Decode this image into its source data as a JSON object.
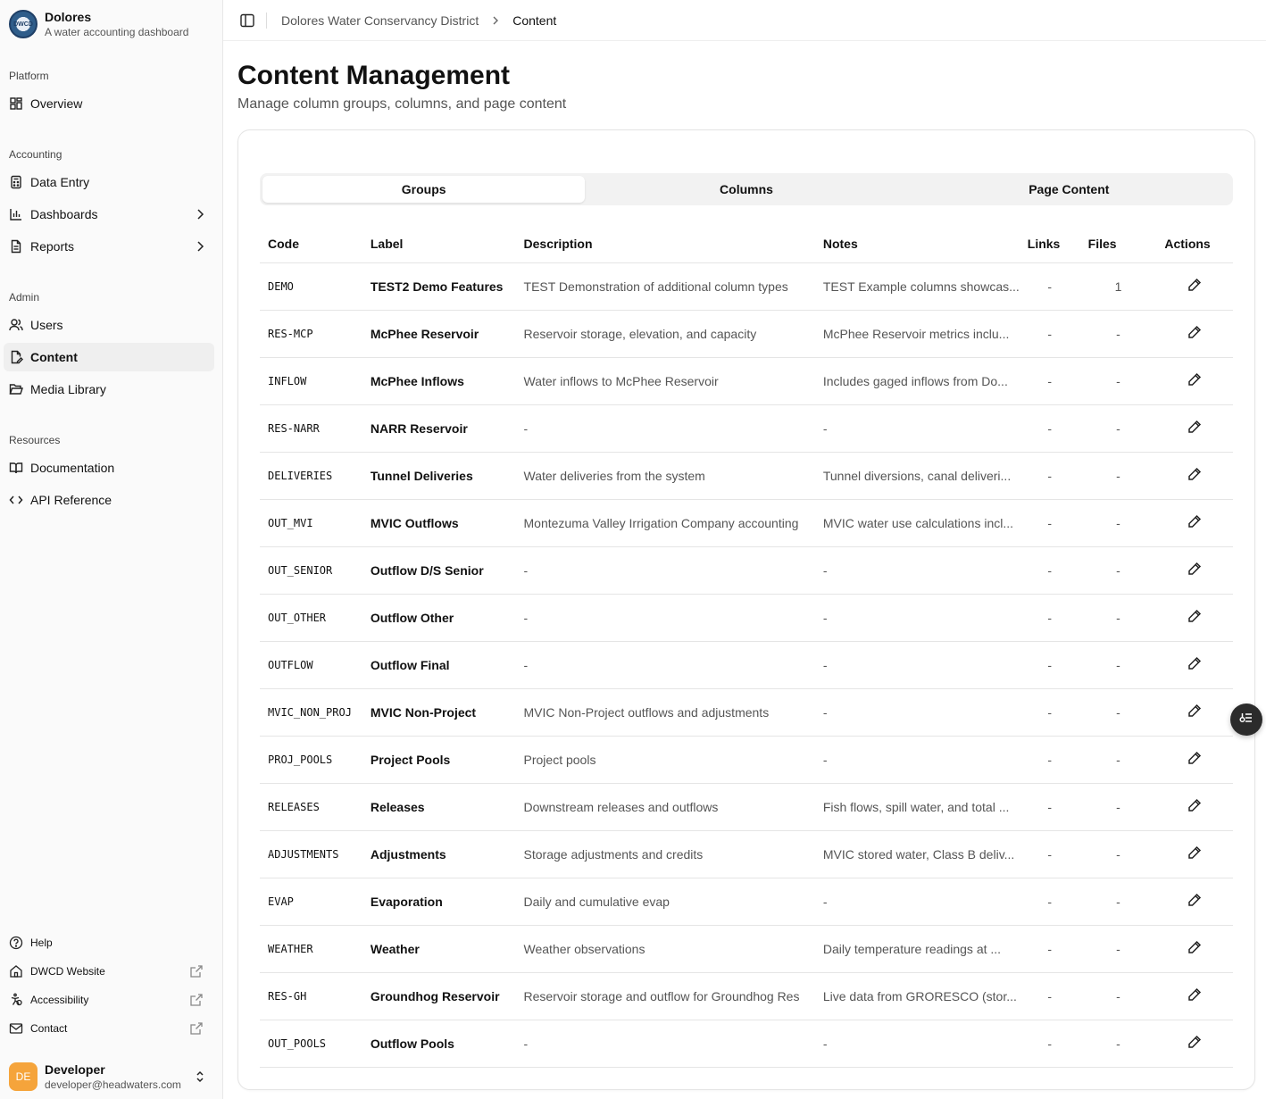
{
  "brand": {
    "title": "Dolores",
    "subtitle": "A water accounting dashboard",
    "logo_text": "DWCD"
  },
  "sections": {
    "platform": "Platform",
    "accounting": "Accounting",
    "admin": "Admin",
    "resources": "Resources"
  },
  "nav": {
    "overview": "Overview",
    "data_entry": "Data Entry",
    "dashboards": "Dashboards",
    "reports": "Reports",
    "users": "Users",
    "content": "Content",
    "media_library": "Media Library",
    "documentation": "Documentation",
    "api_reference": "API Reference"
  },
  "footer": {
    "help": "Help",
    "website": "DWCD Website",
    "accessibility": "Accessibility",
    "contact": "Contact"
  },
  "user": {
    "initials": "DE",
    "name": "Developer",
    "email": "developer@headwaters.com"
  },
  "breadcrumb": {
    "parent": "Dolores Water Conservancy District",
    "current": "Content"
  },
  "page": {
    "title": "Content Management",
    "subtitle": "Manage column groups, columns, and page content"
  },
  "tabs": [
    "Groups",
    "Columns",
    "Page Content"
  ],
  "table": {
    "headers": {
      "code": "Code",
      "label": "Label",
      "description": "Description",
      "notes": "Notes",
      "links": "Links",
      "files": "Files",
      "actions": "Actions"
    },
    "rows": [
      {
        "code": "DEMO",
        "label": "TEST2 Demo Features",
        "description": "TEST Demonstration of additional column types",
        "notes": "TEST Example columns showcas...",
        "links": "-",
        "files": "1"
      },
      {
        "code": "RES-MCP",
        "label": "McPhee Reservoir",
        "description": "Reservoir storage, elevation, and capacity",
        "notes": "McPhee Reservoir metrics inclu...",
        "links": "-",
        "files": "-"
      },
      {
        "code": "INFLOW",
        "label": "McPhee Inflows",
        "description": "Water inflows to McPhee Reservoir",
        "notes": "Includes gaged inflows from Do...",
        "links": "-",
        "files": "-"
      },
      {
        "code": "RES-NARR",
        "label": "NARR Reservoir",
        "description": "-",
        "notes": "-",
        "links": "-",
        "files": "-"
      },
      {
        "code": "DELIVERIES",
        "label": "Tunnel Deliveries",
        "description": "Water deliveries from the system",
        "notes": "Tunnel diversions, canal deliveri...",
        "links": "-",
        "files": "-"
      },
      {
        "code": "OUT_MVI",
        "label": "MVIC Outflows",
        "description": "Montezuma Valley Irrigation Company accounting",
        "notes": "MVIC water use calculations incl...",
        "links": "-",
        "files": "-"
      },
      {
        "code": "OUT_SENIOR",
        "label": "Outflow D/S Senior",
        "description": "-",
        "notes": "-",
        "links": "-",
        "files": "-"
      },
      {
        "code": "OUT_OTHER",
        "label": "Outflow Other",
        "description": "-",
        "notes": "-",
        "links": "-",
        "files": "-"
      },
      {
        "code": "OUTFLOW",
        "label": "Outflow Final",
        "description": "-",
        "notes": "-",
        "links": "-",
        "files": "-"
      },
      {
        "code": "MVIC_NON_PROJ",
        "label": "MVIC Non-Project",
        "description": "MVIC Non-Project outflows and adjustments",
        "notes": "-",
        "links": "-",
        "files": "-"
      },
      {
        "code": "PROJ_POOLS",
        "label": "Project Pools",
        "description": "Project pools",
        "notes": "-",
        "links": "-",
        "files": "-"
      },
      {
        "code": "RELEASES",
        "label": "Releases",
        "description": "Downstream releases and outflows",
        "notes": "Fish flows, spill water, and total ...",
        "links": "-",
        "files": "-"
      },
      {
        "code": "ADJUSTMENTS",
        "label": "Adjustments",
        "description": "Storage adjustments and credits",
        "notes": "MVIC stored water, Class B deliv...",
        "links": "-",
        "files": "-"
      },
      {
        "code": "EVAP",
        "label": "Evaporation",
        "description": "Daily and cumulative evap",
        "notes": "-",
        "links": "-",
        "files": "-"
      },
      {
        "code": "WEATHER",
        "label": "Weather",
        "description": "Weather observations",
        "notes": "Daily temperature readings at ...",
        "links": "-",
        "files": "-"
      },
      {
        "code": "RES-GH",
        "label": "Groundhog Reservoir",
        "description": "Reservoir storage and outflow for Groundhog Res",
        "notes": "Live data from GRORESCO (stor...",
        "links": "-",
        "files": "-"
      },
      {
        "code": "OUT_POOLS",
        "label": "Outflow Pools",
        "description": "-",
        "notes": "-",
        "links": "-",
        "files": "-"
      }
    ]
  }
}
